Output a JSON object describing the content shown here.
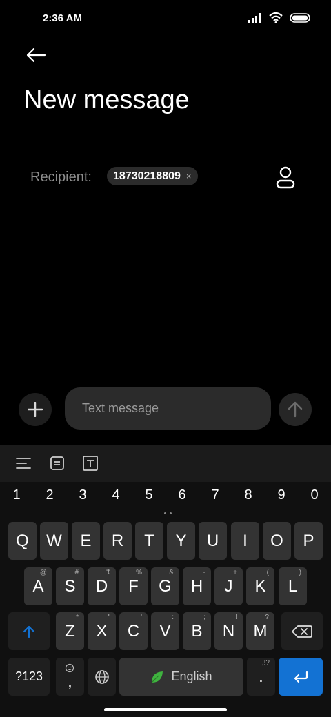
{
  "status_bar": {
    "time": "2:36 AM",
    "icons": [
      "signal-icon",
      "wifi-icon",
      "battery-icon"
    ]
  },
  "header": {
    "back_icon": "arrow-left-icon",
    "title": "New message"
  },
  "recipient": {
    "label": "Recipient:",
    "chips": [
      {
        "number": "18730218809",
        "remove": "×"
      }
    ],
    "contact_icon": "contact-icon"
  },
  "compose": {
    "placeholder": "Text message",
    "add_icon": "plus-icon",
    "send_icon": "arrow-up-icon"
  },
  "keyboard": {
    "toolbar": [
      "menu-icon",
      "clipboard-icon",
      "text-format-icon"
    ],
    "numbers": [
      "1",
      "2",
      "3",
      "4",
      "5",
      "6",
      "7",
      "8",
      "9",
      "0"
    ],
    "row1": [
      {
        "k": "Q"
      },
      {
        "k": "W"
      },
      {
        "k": "E"
      },
      {
        "k": "R"
      },
      {
        "k": "T"
      },
      {
        "k": "Y"
      },
      {
        "k": "U"
      },
      {
        "k": "I"
      },
      {
        "k": "O"
      },
      {
        "k": "P"
      }
    ],
    "row2": [
      {
        "k": "A",
        "h": "@"
      },
      {
        "k": "S",
        "h": "#"
      },
      {
        "k": "D",
        "h": "₹"
      },
      {
        "k": "F",
        "h": "%"
      },
      {
        "k": "G",
        "h": "&"
      },
      {
        "k": "H",
        "h": "-"
      },
      {
        "k": "J",
        "h": "+"
      },
      {
        "k": "K",
        "h": "("
      },
      {
        "k": "L",
        "h": ")"
      }
    ],
    "row3": [
      {
        "k": "Z",
        "h": "*"
      },
      {
        "k": "X",
        "h": "\""
      },
      {
        "k": "C",
        "h": "'"
      },
      {
        "k": "V",
        "h": ":"
      },
      {
        "k": "B",
        "h": ";"
      },
      {
        "k": "N",
        "h": "!"
      },
      {
        "k": "M",
        "h": "?"
      }
    ],
    "symbols_key": "?123",
    "comma_key": ",",
    "space_label": "English",
    "period_key": ".",
    "period_hint": ",!?"
  },
  "colors": {
    "accent": "#1372d3",
    "background": "#000000",
    "key": "#333333"
  }
}
